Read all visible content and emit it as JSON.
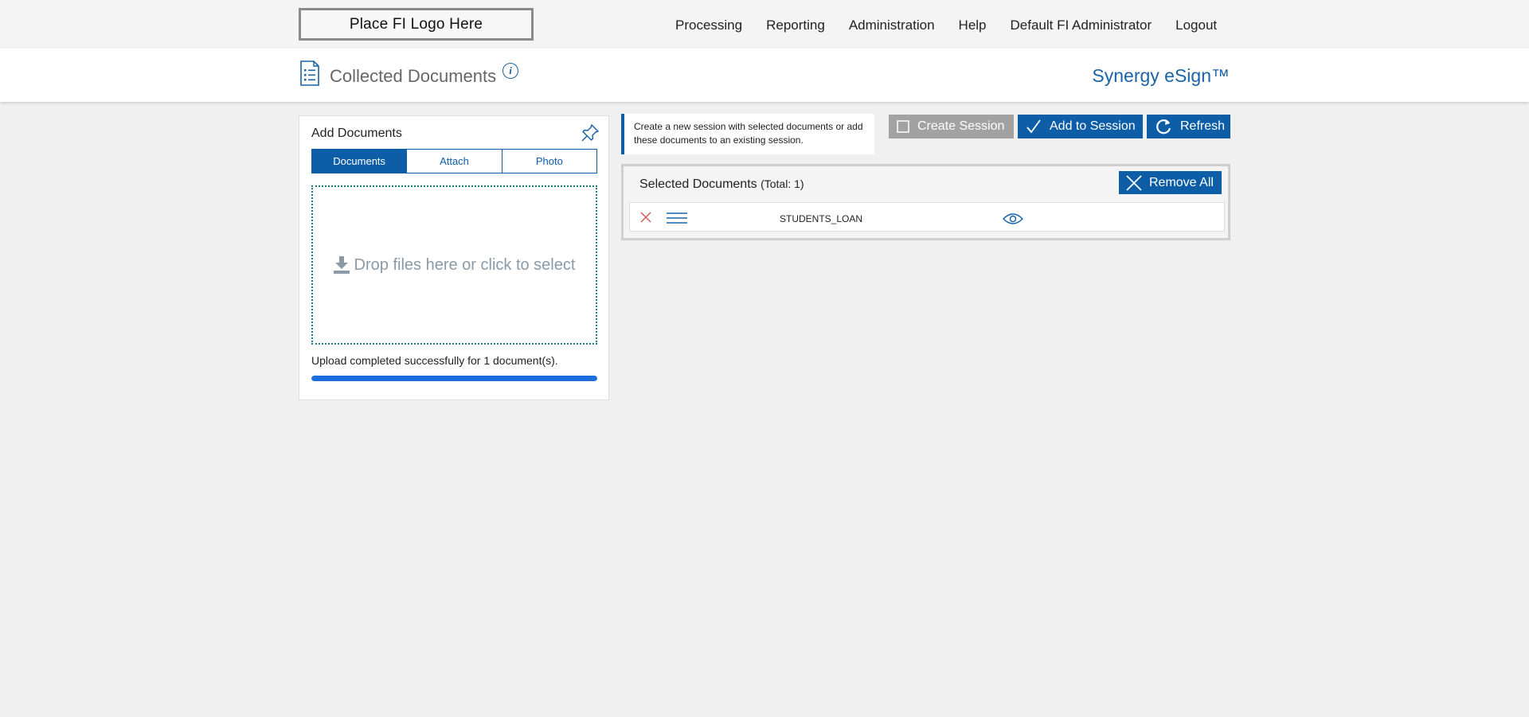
{
  "logo": {
    "text": "Place FI Logo Here"
  },
  "nav": {
    "items": [
      {
        "label": "Processing"
      },
      {
        "label": "Reporting"
      },
      {
        "label": "Administration"
      },
      {
        "label": "Help"
      },
      {
        "label": "Default FI Administrator"
      },
      {
        "label": "Logout"
      }
    ]
  },
  "header": {
    "title": "Collected Documents",
    "title_icon": "document-list-icon",
    "info_icon": "info-icon",
    "info_glyph": "i",
    "brand": "Synergy eSign™"
  },
  "add_documents": {
    "title": "Add Documents",
    "pin_icon": "pin-icon",
    "tabs": [
      {
        "label": "Documents",
        "active": true
      },
      {
        "label": "Attach",
        "active": false
      },
      {
        "label": "Photo",
        "active": false
      }
    ],
    "dropzone_text": "Drop files here or click to select",
    "dropzone_icon": "download-icon",
    "upload_status": "Upload completed successfully for 1 document(s).",
    "upload_progress": 1.0
  },
  "actions": {
    "hint": "Create a new session with selected documents or add these documents to an existing session.",
    "create_session": "Create Session",
    "add_to_session": "Add to Session",
    "refresh": "Refresh"
  },
  "selected_documents": {
    "title": "Selected Documents",
    "total_text": "(Total: 1)",
    "remove_all": "Remove All",
    "rows": [
      {
        "name": "STUDENTS_LOAN"
      }
    ]
  },
  "colors": {
    "brand_blue": "#0d5ea6",
    "disabled_gray": "#a2a2a2",
    "progress_blue": "#1d6fe0",
    "delete_red": "#d9534f"
  }
}
